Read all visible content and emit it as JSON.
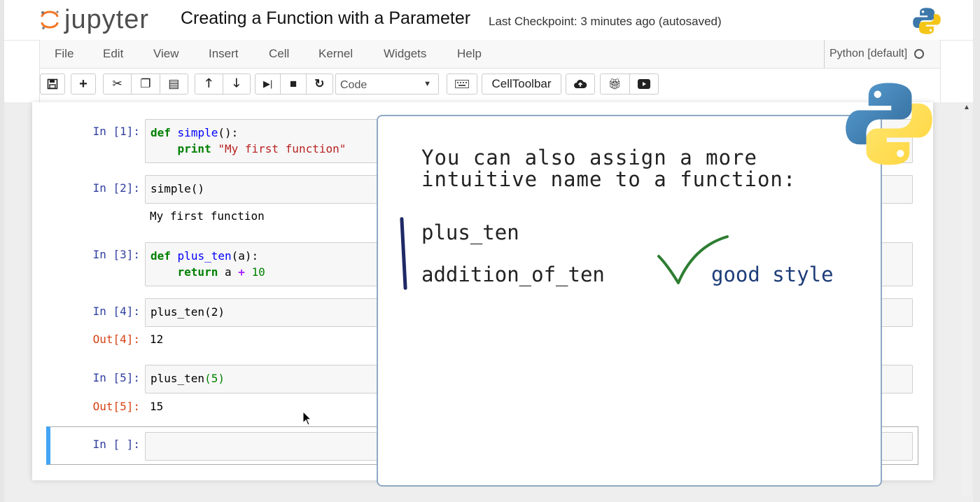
{
  "header": {
    "logo_text": "jupyter",
    "notebook_title": "Creating a Function with a Parameter",
    "checkpoint": "Last Checkpoint: 3 minutes ago (autosaved)"
  },
  "menubar": {
    "items": [
      "File",
      "Edit",
      "View",
      "Insert",
      "Cell",
      "Kernel",
      "Widgets",
      "Help"
    ],
    "kernel_name": "Python [default]"
  },
  "toolbar": {
    "cell_type": "Code",
    "cell_toolbar_label": "CellToolbar",
    "icons": [
      "save-icon",
      "plus-icon",
      "scissors-icon",
      "copy-icon",
      "paste-icon",
      "arrow-up-icon",
      "arrow-down-icon",
      "step-forward-icon",
      "stop-icon",
      "restart-icon",
      "keyboard-icon",
      "cloud-upload-icon",
      "gift-icon",
      "play-video-icon"
    ]
  },
  "cells": [
    {
      "prompt": "In [1]:",
      "line1_kw": "def",
      "line1_fn": "simple",
      "line1_rest": "():",
      "line2_kw": "print",
      "line2_str": "\"My first function\""
    },
    {
      "prompt": "In [2]:",
      "code": "simple()",
      "output": "My first function"
    },
    {
      "prompt": "In [3]:",
      "line1_kw": "def",
      "line1_fn": "plus_ten",
      "line1_rest": "(a):",
      "line2_kw": "return",
      "line2_a": "a",
      "line2_op": "+",
      "line2_num": "10"
    },
    {
      "prompt": "In [4]:",
      "code": "plus_ten(2)",
      "out_prompt": "Out[4]:",
      "output": "12"
    },
    {
      "prompt": "In [5]:",
      "code_fn": "plus_ten",
      "code_arg": "(5)",
      "out_prompt": "Out[5]:",
      "output": "15"
    },
    {
      "prompt": "In [ ]:"
    }
  ],
  "overlay": {
    "heading_line1": "You can also assign a more",
    "heading_line2": "intuitive name to a function:",
    "name1": "plus_ten",
    "name2": "addition_of_ten",
    "verdict": "good style"
  },
  "colors": {
    "prompt_in": "#303f9f",
    "prompt_out": "#d84315",
    "check_green": "#2e7d32",
    "verdict_blue": "#1d3c78",
    "selected_cell_bar": "#42a5f5"
  }
}
